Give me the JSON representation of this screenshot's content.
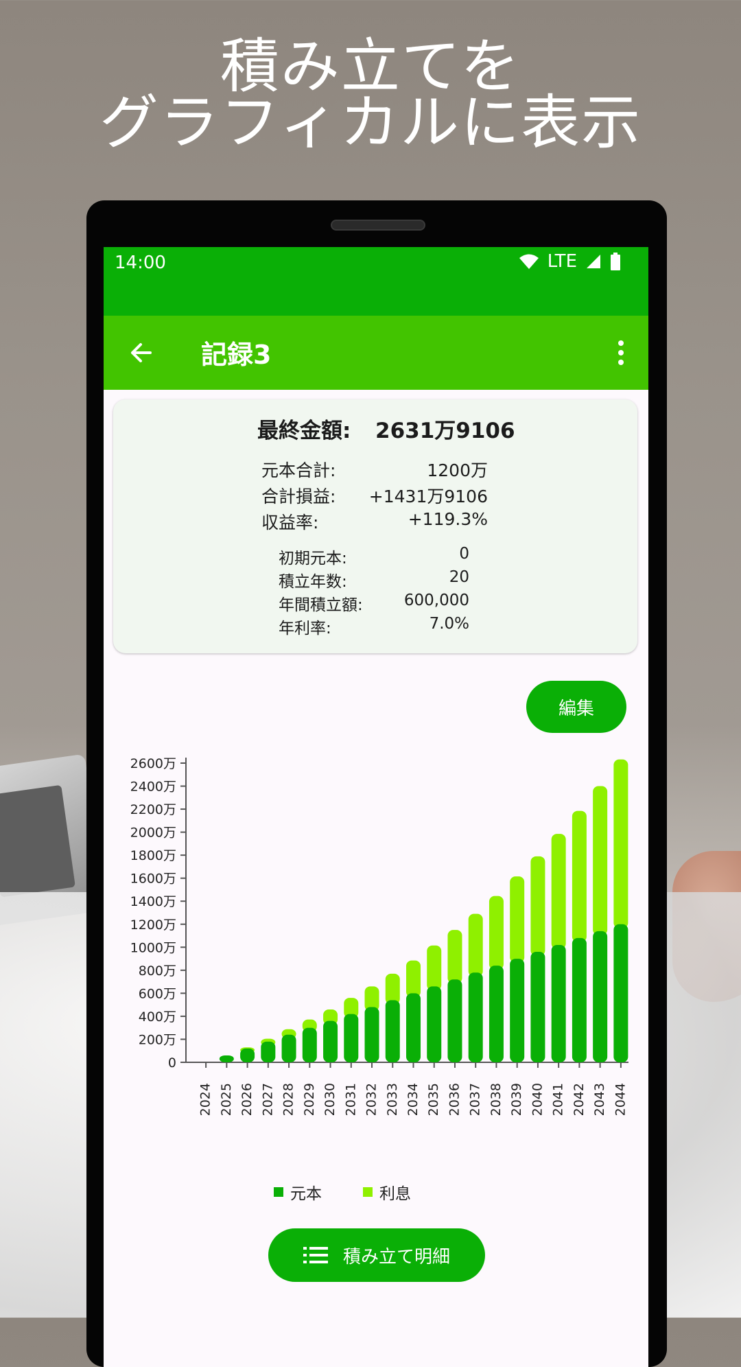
{
  "headline": {
    "line1": "積み立てを",
    "line2": "グラフィカルに表示"
  },
  "status_bar": {
    "time": "14:00",
    "network": "LTE",
    "icons": [
      "wifi-icon",
      "signal-icon",
      "battery-icon"
    ]
  },
  "app_bar": {
    "title": "記録3",
    "back_icon": "arrow-left-icon",
    "menu_icon": "more-vert-icon"
  },
  "summary": {
    "final_label": "最終金額:",
    "final_value": "2631万9106",
    "stats": [
      {
        "label": "元本合計:",
        "value": "1200万"
      },
      {
        "label": "合計損益:",
        "value": "+1431万9106"
      },
      {
        "label": "収益率:",
        "value": "+119.3%"
      }
    ],
    "params": [
      {
        "label": "初期元本:",
        "value": "0"
      },
      {
        "label": "積立年数:",
        "value": "20"
      },
      {
        "label": "年間積立額:",
        "value": "600,000"
      },
      {
        "label": "年利率:",
        "value": "7.0%"
      }
    ]
  },
  "edit_button": "編集",
  "detail_button": "積み立て明細",
  "colors": {
    "status_bar": "#0aaf06",
    "app_bar": "#42c400",
    "principal": "#0aaf06",
    "interest": "#8ff000"
  },
  "chart_data": {
    "type": "bar",
    "stacked": true,
    "categories": [
      "2024",
      "2025",
      "2026",
      "2027",
      "2028",
      "2029",
      "2030",
      "2031",
      "2032",
      "2033",
      "2034",
      "2035",
      "2036",
      "2037",
      "2038",
      "2039",
      "2040",
      "2041",
      "2042",
      "2043",
      "2044"
    ],
    "series": [
      {
        "name": "元本",
        "values": [
          0,
          60,
          120,
          180,
          240,
          300,
          360,
          420,
          480,
          540,
          600,
          660,
          720,
          780,
          840,
          900,
          960,
          1020,
          1080,
          1140,
          1200
        ]
      },
      {
        "name": "利息",
        "values": [
          0,
          0,
          10,
          25,
          48,
          72,
          99,
          140,
          180,
          230,
          285,
          355,
          430,
          510,
          605,
          715,
          830,
          965,
          1105,
          1260,
          1432
        ]
      }
    ],
    "ylim": [
      0,
      2600
    ],
    "yticks": [
      "0",
      "200万",
      "400万",
      "600万",
      "800万",
      "1000万",
      "1200万",
      "1400万",
      "1600万",
      "1800万",
      "2000万",
      "2200万",
      "2400万",
      "2600万"
    ],
    "ytick_values": [
      0,
      200,
      400,
      600,
      800,
      1000,
      1200,
      1400,
      1600,
      1800,
      2000,
      2200,
      2400,
      2600
    ],
    "legend_position": "bottom",
    "grid": false
  }
}
